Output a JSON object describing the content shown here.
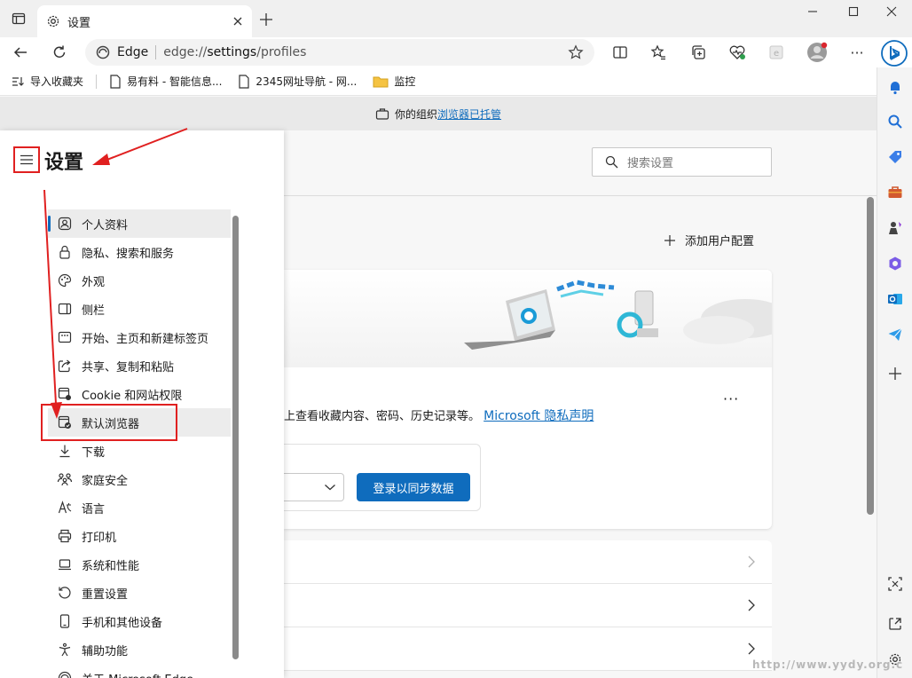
{
  "tab": {
    "title": "设置"
  },
  "address": {
    "site": "Edge",
    "url_prefix": "edge://",
    "url_bold": "settings",
    "url_suffix": "/profiles"
  },
  "bookmarks": [
    {
      "label": "导入收藏夹",
      "icon": "import-icon"
    },
    {
      "label": "易有料 - 智能信息...",
      "icon": "page-icon"
    },
    {
      "label": "2345网址导航 - 网...",
      "icon": "page-icon"
    },
    {
      "label": "监控",
      "icon": "folder-icon"
    }
  ],
  "banner": {
    "text": "你的组织",
    "link": "浏览器已托管"
  },
  "settings": {
    "title": "设置",
    "menu": [
      {
        "label": "个人资料",
        "icon": "profile-icon",
        "active": true
      },
      {
        "label": "隐私、搜索和服务",
        "icon": "lock-icon"
      },
      {
        "label": "外观",
        "icon": "palette-icon"
      },
      {
        "label": "侧栏",
        "icon": "sidebar-icon"
      },
      {
        "label": "开始、主页和新建标签页",
        "icon": "home-tabs-icon"
      },
      {
        "label": "共享、复制和粘贴",
        "icon": "share-icon"
      },
      {
        "label": "Cookie 和网站权限",
        "icon": "cookie-icon"
      },
      {
        "label": "默认浏览器",
        "icon": "default-browser-icon"
      },
      {
        "label": "下载",
        "icon": "download-icon"
      },
      {
        "label": "家庭安全",
        "icon": "family-icon"
      },
      {
        "label": "语言",
        "icon": "language-icon"
      },
      {
        "label": "打印机",
        "icon": "printer-icon"
      },
      {
        "label": "系统和性能",
        "icon": "system-icon"
      },
      {
        "label": "重置设置",
        "icon": "reset-icon"
      },
      {
        "label": "手机和其他设备",
        "icon": "phone-icon"
      },
      {
        "label": "辅助功能",
        "icon": "accessibility-icon"
      },
      {
        "label": "关于 Microsoft Edge",
        "icon": "edge-icon"
      }
    ]
  },
  "main": {
    "search_placeholder": "搜索设置",
    "add_profile": "添加用户配置",
    "more": "···",
    "desc_text": "上查看收藏内容、密码、历史记录等。",
    "desc_link": "Microsoft 隐私声明",
    "signin_button": "登录以同步数据"
  },
  "watermark": "http://www.yydy.org.c"
}
